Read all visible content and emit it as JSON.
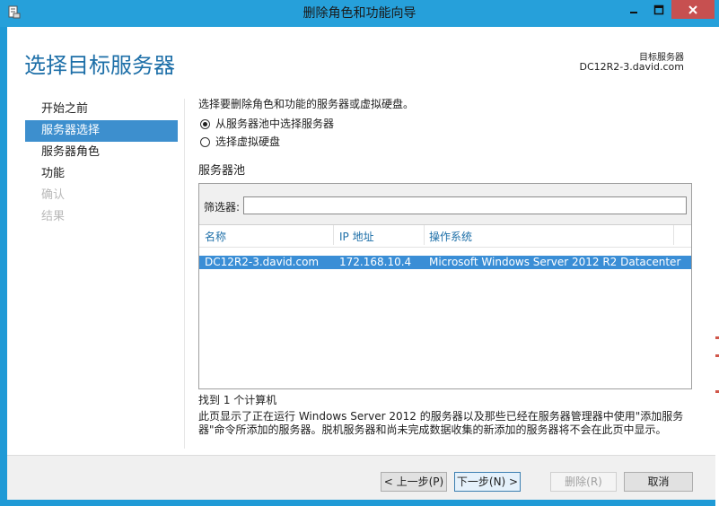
{
  "window": {
    "title": "删除角色和功能向导"
  },
  "header": {
    "page_title": "选择目标服务器",
    "destination_label": "目标服务器",
    "destination_server": "DC12R2-3.david.com"
  },
  "nav": {
    "items": [
      {
        "label": "开始之前",
        "state": "normal"
      },
      {
        "label": "服务器选择",
        "state": "active"
      },
      {
        "label": "服务器角色",
        "state": "normal"
      },
      {
        "label": "功能",
        "state": "normal"
      },
      {
        "label": "确认",
        "state": "disabled"
      },
      {
        "label": "结果",
        "state": "disabled"
      }
    ]
  },
  "main": {
    "instruction": "选择要删除角色和功能的服务器或虚拟硬盘。",
    "options": [
      {
        "label": "从服务器池中选择服务器",
        "checked": true
      },
      {
        "label": "选择虚拟硬盘",
        "checked": false
      }
    ],
    "pool_label": "服务器池",
    "filter": {
      "label": "筛选器:",
      "value": "",
      "placeholder": ""
    },
    "table": {
      "columns": [
        "名称",
        "IP 地址",
        "操作系统"
      ],
      "rows": [
        {
          "name": "DC12R2-3.david.com",
          "ip": "172.168.10.4",
          "os": "Microsoft Windows Server 2012 R2 Datacenter"
        }
      ]
    },
    "found": "找到 1 个计算机",
    "note": "此页显示了正在运行 Windows Server 2012 的服务器以及那些已经在服务器管理器中使用\"添加服务器\"命令所添加的服务器。脱机服务器和尚未完成数据收集的新添加的服务器将不会在此页中显示。"
  },
  "footer": {
    "prev": "< 上一步(P)",
    "next": "下一步(N) >",
    "remove": "删除(R)",
    "cancel": "取消"
  },
  "colors": {
    "title_bar": "#26a0da",
    "accent": "#1d6fa8",
    "selection": "#3a8ed6",
    "close": "#c75050"
  },
  "icons": [
    "app-wizard-icon",
    "minimize-icon",
    "maximize-icon",
    "close-icon"
  ]
}
